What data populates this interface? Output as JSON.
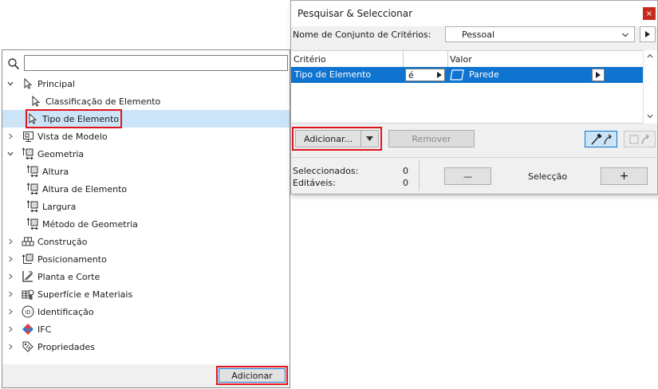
{
  "tree_panel": {
    "search": {
      "value": "",
      "placeholder": ""
    },
    "items": [
      {
        "label": "Principal",
        "expanded": true,
        "icon": "arrow-cursor-icon"
      },
      {
        "label": "Classificação de Elemento",
        "icon": "arrow-cursor-icon"
      },
      {
        "label": "Tipo de Elemento",
        "icon": "arrow-cursor-icon",
        "selected": true
      },
      {
        "label": "Vista de Modelo",
        "expanded": false,
        "icon": "model-view-icon"
      },
      {
        "label": "Geometria",
        "expanded": true,
        "icon": "geometry-icon"
      },
      {
        "label": "Altura",
        "icon": "geometry-icon"
      },
      {
        "label": "Altura de Elemento",
        "icon": "geometry-icon"
      },
      {
        "label": "Largura",
        "icon": "geometry-icon"
      },
      {
        "label": "Método de Geometria",
        "icon": "geometry-icon"
      },
      {
        "label": "Construção",
        "expanded": false,
        "icon": "construction-icon"
      },
      {
        "label": "Posicionamento",
        "expanded": false,
        "icon": "positioning-icon"
      },
      {
        "label": "Planta e Corte",
        "expanded": false,
        "icon": "plan-section-icon"
      },
      {
        "label": "Superfície e Materiais",
        "expanded": false,
        "icon": "surface-materials-icon"
      },
      {
        "label": "Identificação",
        "expanded": false,
        "icon": "id-icon"
      },
      {
        "label": "IFC",
        "expanded": false,
        "icon": "ifc-icon"
      },
      {
        "label": "Propriedades",
        "expanded": false,
        "icon": "properties-icon"
      }
    ],
    "add_button": "Adicionar"
  },
  "dialog": {
    "title": "Pesquisar & Seleccionar",
    "close_label": "×",
    "criteria_set": {
      "label": "Nome de Conjunto de Critérios:",
      "value": "Pessoal"
    },
    "table": {
      "columns": [
        "Critério",
        "Valor"
      ],
      "rows": [
        {
          "criterion": "Tipo de Elemento",
          "operator": "é",
          "value": "Parede"
        }
      ]
    },
    "add_button": "Adicionar...",
    "remove_button": "Remover",
    "counts": {
      "selected_label": "Seleccionados:",
      "selected_value": "0",
      "editable_label": "Editáveis:",
      "editable_value": "0"
    },
    "selection_label": "Selecção",
    "minus_label": "—",
    "plus_label": "+"
  },
  "colors": {
    "accent": "#0f74d0",
    "highlight_box": "#e0141c",
    "selected_row": "#cce4f7"
  }
}
